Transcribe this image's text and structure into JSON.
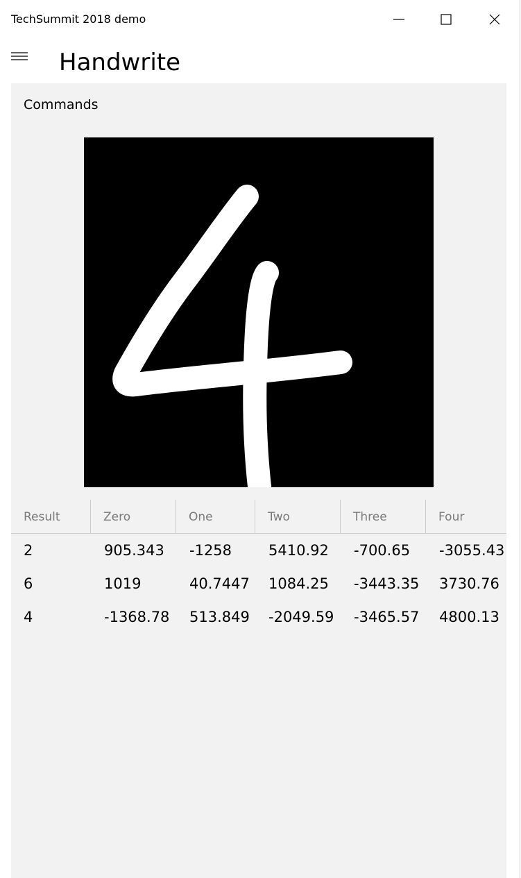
{
  "window": {
    "title": "TechSummit 2018 demo",
    "icons": {
      "minimize": "minimize-icon",
      "maximize": "maximize-icon",
      "close": "close-icon"
    }
  },
  "header": {
    "menu_icon": "hamburger-menu-icon",
    "page_title": "Handwrite"
  },
  "commands": {
    "label": "Commands",
    "canvas_background": "#000000",
    "stroke_color": "#ffffff"
  },
  "results_table": {
    "columns": [
      "Result",
      "Zero",
      "One",
      "Two",
      "Three",
      "Four"
    ],
    "rows": [
      [
        "2",
        "905.343",
        "-1258",
        "5410.92",
        "-700.65",
        "-3055.43"
      ],
      [
        "6",
        "1019",
        "40.7447",
        "1084.25",
        "-3443.35",
        "3730.76"
      ],
      [
        "4",
        "-1368.78",
        "513.849",
        "-2049.59",
        "-3465.57",
        "4800.13"
      ]
    ]
  },
  "colors": {
    "content_background": "#f2f2f2",
    "header_text": "#7a7a7a",
    "grid_line": "#cccccc"
  }
}
